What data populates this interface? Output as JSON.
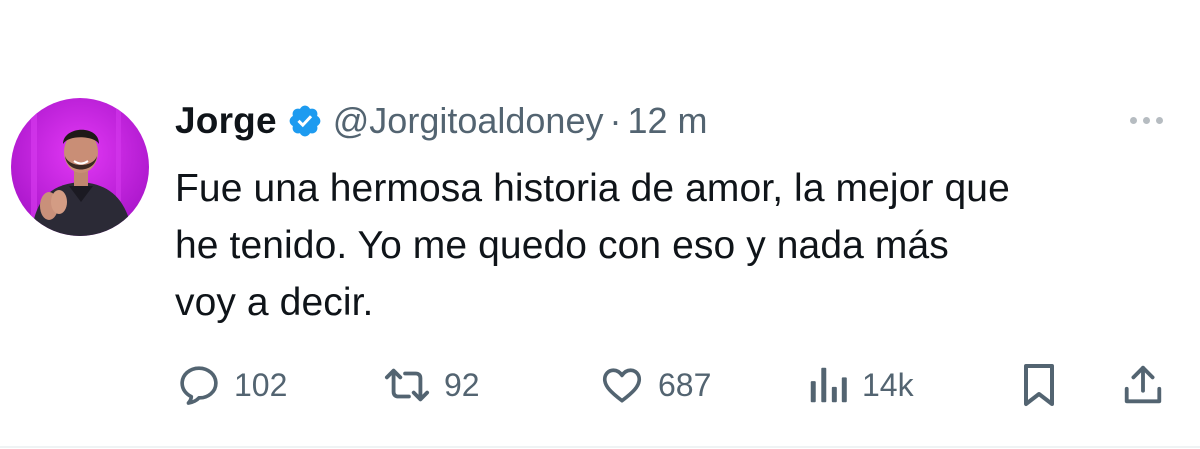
{
  "tweet": {
    "author": {
      "display_name": "Jorge",
      "handle": "@Jorgitoaldoney",
      "verified": true,
      "verified_color": "#1d9bf0"
    },
    "separator": "·",
    "time": "12 m",
    "text_lines": [
      "Fue una hermosa historia de amor, la mejor que",
      "he tenido. Yo me quedo con eso y nada más",
      "voy a decir."
    ],
    "metrics": {
      "replies": "102",
      "retweets": "92",
      "likes": "687",
      "views": "14k"
    }
  },
  "icons": {
    "more": "more-horizontal-icon",
    "reply": "reply-icon",
    "retweet": "retweet-icon",
    "like": "heart-icon",
    "views": "analytics-icon",
    "bookmark": "bookmark-icon",
    "share": "share-icon"
  },
  "colors": {
    "text": "#0f1419",
    "secondary": "#536471",
    "avatar_bg": "#c21fd6"
  }
}
